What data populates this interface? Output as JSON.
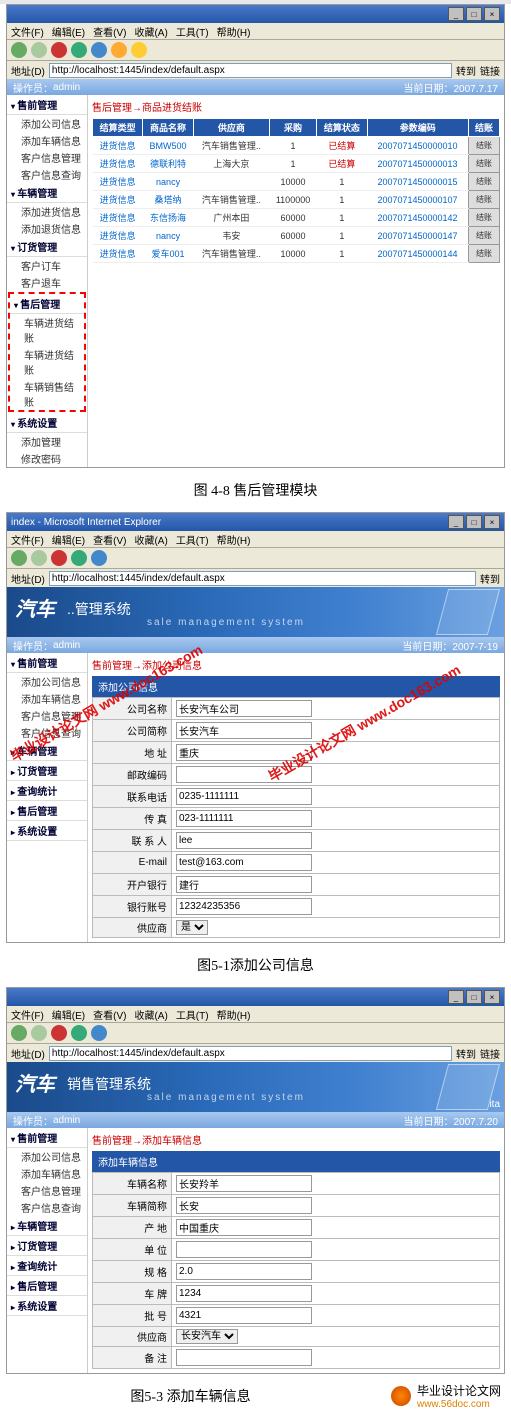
{
  "browser": {
    "title_suffix": " - Microsoft Internet Explorer",
    "menus": [
      "文件(F)",
      "编辑(E)",
      "查看(V)",
      "收藏(A)",
      "工具(T)",
      "帮助(H)"
    ],
    "address_label": "地址(D)",
    "url": "http://localhost:1445/index/default.aspx",
    "go": "转到",
    "links": "链接"
  },
  "banner": {
    "logo": "汽车",
    "sub": "销售管理系统",
    "eng": "sale management system",
    "brand_suffix": "ita"
  },
  "userbar": {
    "label": "操作员：",
    "user": "admin",
    "date_label": "当前日期：",
    "date1": "2007.7.17",
    "date2": "2007-7-19",
    "date3": "2007.7.20"
  },
  "sidebar": {
    "groups": [
      {
        "name": "售前管理",
        "items": [
          "添加公司信息",
          "添加车辆信息",
          "客户信息管理",
          "客户信息查询"
        ]
      },
      {
        "name": "车辆管理",
        "items": [
          "添加进货信息",
          "添加退货信息"
        ]
      },
      {
        "name": "订货管理",
        "items": [
          "客户订车",
          "客户退车"
        ]
      },
      {
        "name": "售后管理",
        "items": [
          "车辆进货结账",
          "车辆进货结账",
          "车辆销售结账"
        ]
      },
      {
        "name": "系统设置",
        "items": [
          "添加管理",
          "修改密码"
        ]
      },
      {
        "name": "查询统计",
        "items": []
      }
    ]
  },
  "shot1": {
    "crumb": "售后管理→商品进货结账",
    "headers": [
      "结算类型",
      "商品名称",
      "供应商",
      "采购",
      "结算状态",
      "参数编码",
      "结账"
    ],
    "rows": [
      [
        "进货信息",
        "BMW500",
        "汽车销售管理..",
        "1",
        "已结算",
        "2007071450000010",
        "结账"
      ],
      [
        "进货信息",
        "德联利特",
        "上海大京",
        "1",
        "已结算",
        "2007071450000013",
        "结账"
      ],
      [
        "进货信息",
        "nancy",
        "",
        "10000",
        "1",
        "2007071450000015",
        "结账"
      ],
      [
        "进货信息",
        "桑塔纳",
        "汽车销售管理..",
        "1100000",
        "1",
        "2007071450000107",
        "结账"
      ],
      [
        "进货信息",
        "东信扬海",
        "广州本田",
        "60000",
        "1",
        "2007071450000142",
        "结账"
      ],
      [
        "进货信息",
        "nancy",
        "韦安",
        "60000",
        "1",
        "2007071450000147",
        "结账"
      ],
      [
        "进货信息",
        "爱车001",
        "汽车销售管理..",
        "10000",
        "1",
        "2007071450000144",
        "结账"
      ]
    ]
  },
  "caption1": "图 4-8 售后管理模块",
  "shot2": {
    "title": "index - Microsoft Internet Explorer",
    "crumb": "售前管理→添加公司信息",
    "form_header": "添加公司信息",
    "fields": [
      {
        "label": "公司名称",
        "value": "长安汽车公司"
      },
      {
        "label": "公司简称",
        "value": "长安汽车"
      },
      {
        "label": "地 址",
        "value": "重庆"
      },
      {
        "label": "邮政编码",
        "value": ""
      },
      {
        "label": "联系电话",
        "value": "0235-1111111"
      },
      {
        "label": "传 真",
        "value": "023-1111111"
      },
      {
        "label": "联 系 人",
        "value": "lee"
      },
      {
        "label": "E-mail",
        "value": "test@163.com"
      },
      {
        "label": "开户银行",
        "value": "建行"
      },
      {
        "label": "银行账号",
        "value": "12324235356"
      },
      {
        "label": "供应商",
        "value": "是",
        "type": "select"
      }
    ]
  },
  "caption2": "图5-1添加公司信息",
  "shot3": {
    "crumb": "售前管理→添加车辆信息",
    "form_header": "添加车辆信息",
    "fields": [
      {
        "label": "车辆名称",
        "value": "长安羚羊"
      },
      {
        "label": "车辆简称",
        "value": "长安"
      },
      {
        "label": "产 地",
        "value": "中国重庆"
      },
      {
        "label": "单 位",
        "value": ""
      },
      {
        "label": "规 格",
        "value": "2.0"
      },
      {
        "label": "车 牌",
        "value": "1234"
      },
      {
        "label": "批 号",
        "value": "4321"
      },
      {
        "label": "供应商",
        "value": "长安汽车",
        "type": "select"
      },
      {
        "label": "备 注",
        "value": ""
      }
    ]
  },
  "caption3": "图5-3 添加车辆信息",
  "watermark": {
    "text1": "毕业设计论文网",
    "url": "www.doc163.com"
  },
  "footer": {
    "text": "毕业设计论文网",
    "url": "www.56doc.com"
  }
}
